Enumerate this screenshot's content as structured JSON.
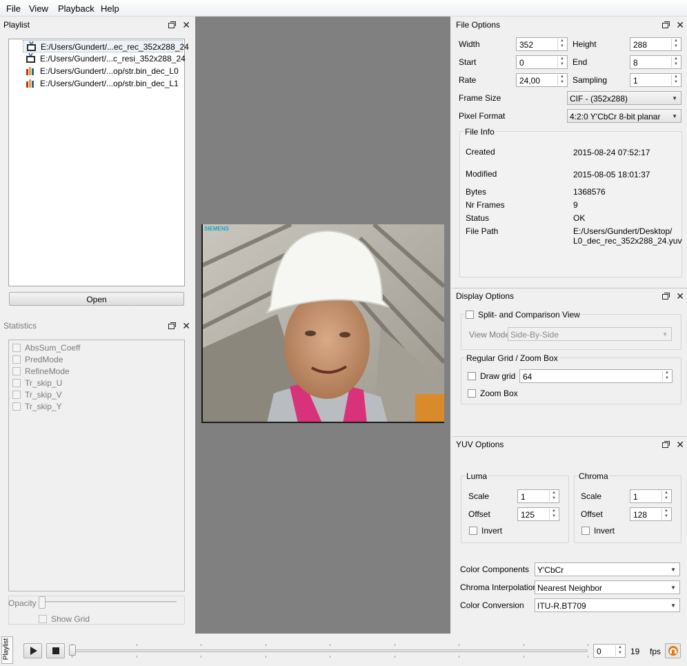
{
  "menu": [
    "File",
    "View",
    "Playback",
    "Help"
  ],
  "playlist": {
    "title": "Playlist",
    "items": [
      {
        "label": "E:/Users/Gundert/...ec_rec_352x288_24",
        "icon": "video-file-icon"
      },
      {
        "label": "E:/Users/Gundert/...c_resi_352x288_24",
        "icon": "video-file-icon"
      },
      {
        "label": "E:/Users/Gundert/...op/str.bin_dec_L0",
        "icon": "statistics-file-icon"
      },
      {
        "label": "E:/Users/Gundert/...op/str.bin_dec_L1",
        "icon": "statistics-file-icon"
      }
    ],
    "open_label": "Open"
  },
  "statistics": {
    "title": "Statistics",
    "items": [
      "AbsSum_Coeff",
      "PredMode",
      "RefineMode",
      "Tr_skip_U",
      "Tr_skip_V",
      "Tr_skip_Y"
    ],
    "opacity_label": "Opacity",
    "show_grid_label": "Show Grid"
  },
  "video": {
    "watermark": "SIEMENS"
  },
  "file_options": {
    "title": "File Options",
    "width_label": "Width",
    "width": "352",
    "height_label": "Height",
    "height": "288",
    "start_label": "Start",
    "start": "0",
    "end_label": "End",
    "end": "8",
    "rate_label": "Rate",
    "rate": "24,00",
    "sampling_label": "Sampling",
    "sampling": "1",
    "frame_size_label": "Frame Size",
    "frame_size": "CIF - (352x288)",
    "pixel_format_label": "Pixel Format",
    "pixel_format": "4:2:0 Y'CbCr 8-bit planar",
    "file_info": {
      "title": "File Info",
      "created_label": "Created",
      "created": "2015-08-24 07:52:17",
      "modified_label": "Modified",
      "modified": "2015-08-05 18:01:37",
      "bytes_label": "Bytes",
      "bytes": "1368576",
      "nr_frames_label": "Nr Frames",
      "nr_frames": "9",
      "status_label": "Status",
      "status": "OK",
      "file_path_label": "File Path",
      "file_path_1": "E:/Users/Gundert/Desktop/",
      "file_path_2": "L0_dec_rec_352x288_24.yuv"
    }
  },
  "display_options": {
    "title": "Display Options",
    "split_label": "Split- and Comparison View",
    "view_mode_label": "View Mode",
    "view_mode": "Side-By-Side",
    "grid_group_title": "Regular Grid / Zoom Box",
    "draw_grid_label": "Draw grid",
    "grid_size": "64",
    "zoom_box_label": "Zoom Box"
  },
  "yuv_options": {
    "title": "YUV Options",
    "luma": {
      "title": "Luma",
      "scale_label": "Scale",
      "scale": "1",
      "offset_label": "Offset",
      "offset": "125",
      "invert_label": "Invert"
    },
    "chroma": {
      "title": "Chroma",
      "scale_label": "Scale",
      "scale": "1",
      "offset_label": "Offset",
      "offset": "128",
      "invert_label": "Invert"
    },
    "color_components_label": "Color Components",
    "color_components": "Y'CbCr",
    "chroma_interp_label": "Chroma Interpolation",
    "chroma_interp": "Nearest Neighbor",
    "color_conversion_label": "Color Conversion",
    "color_conversion": "ITU-R.BT709"
  },
  "playback": {
    "frame": "0",
    "fps": "19",
    "fps_label": "fps",
    "side_tab": "Playlist"
  },
  "colors": {
    "viewer_bg": "#808080",
    "watermark": "#1aa3c8"
  }
}
